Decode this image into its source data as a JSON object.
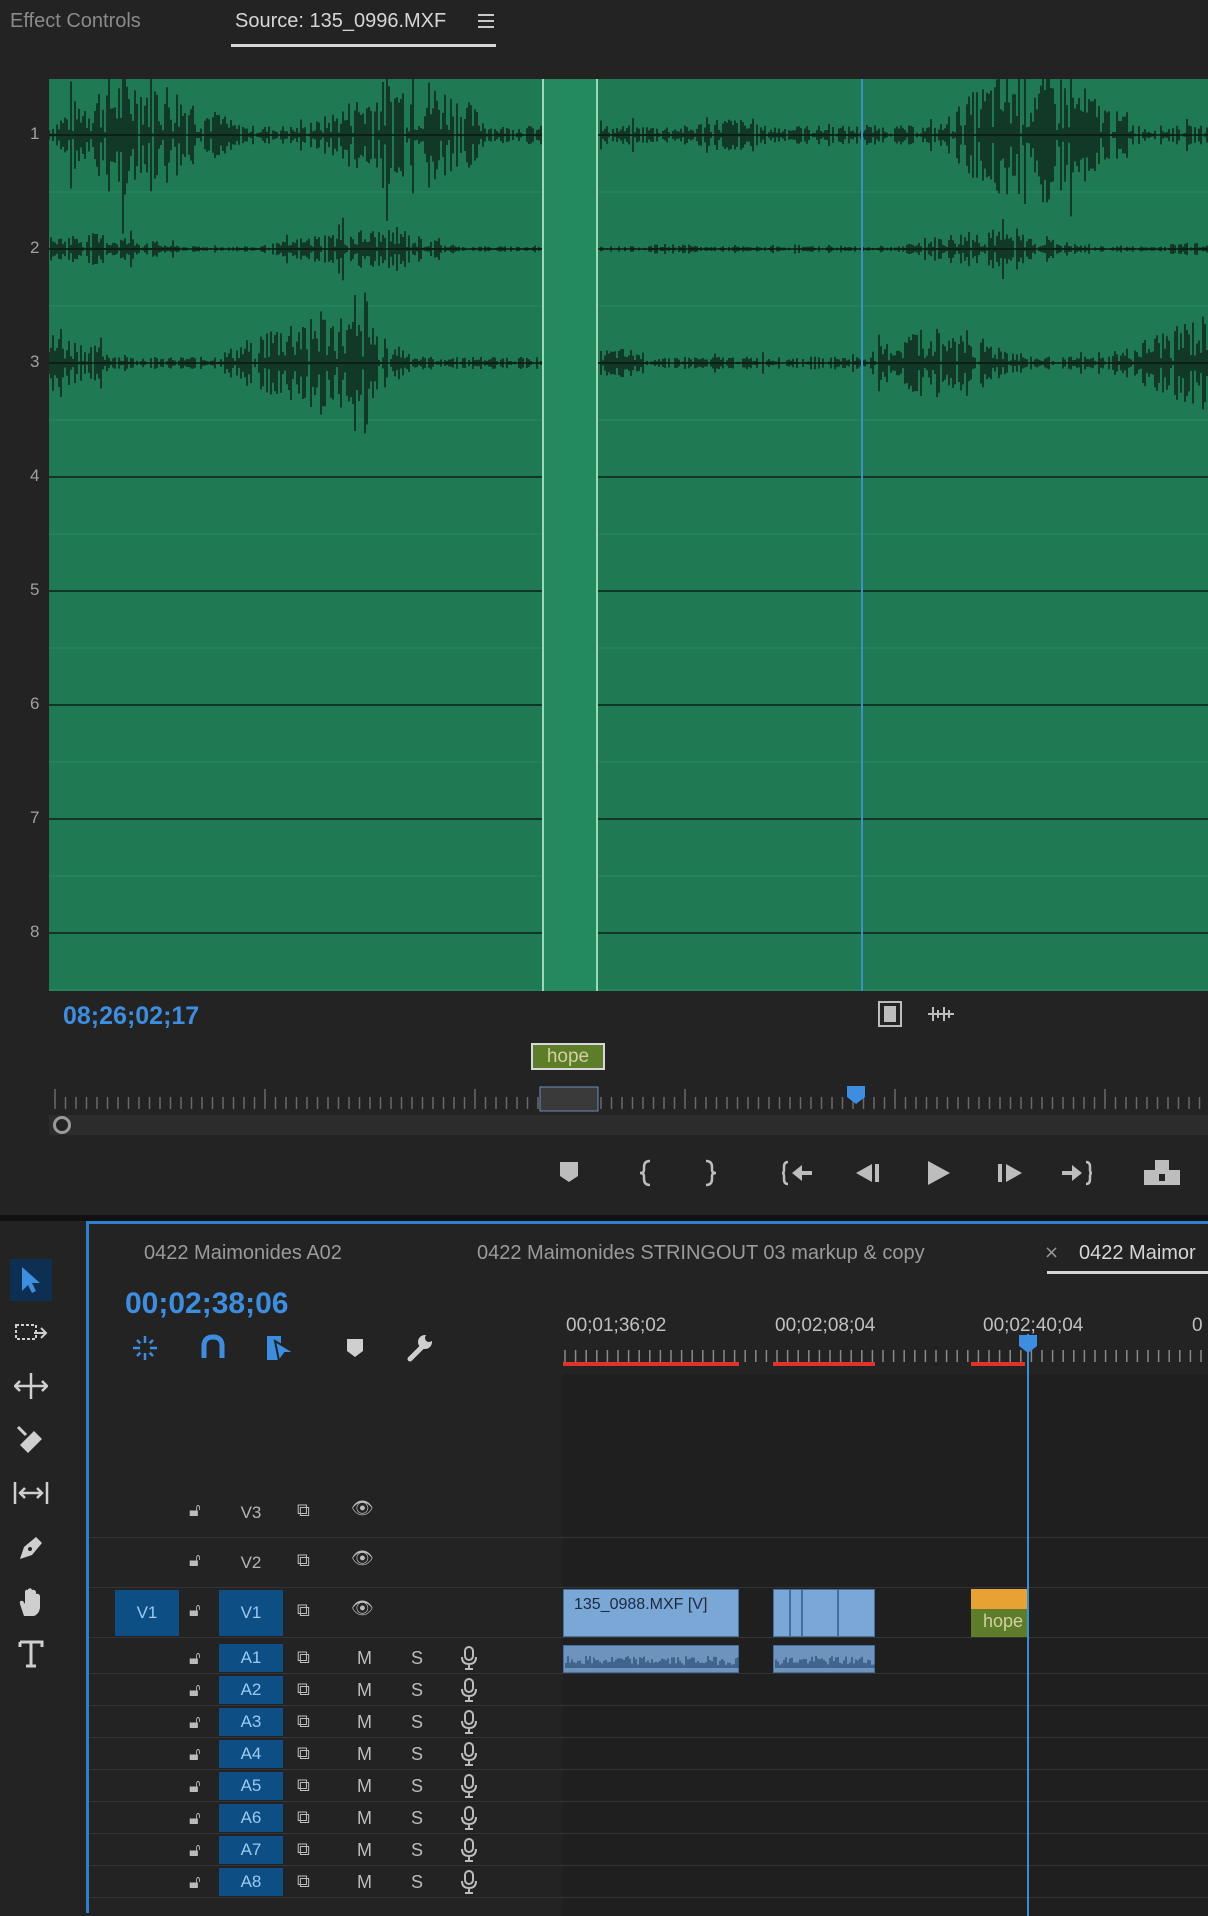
{
  "source_panel": {
    "tabs": [
      "Effect Controls",
      "Source: 135_0996.MXF"
    ],
    "channels": [
      "1",
      "2",
      "3",
      "4",
      "5",
      "6",
      "7",
      "8"
    ],
    "timecode": "08;26;02;17",
    "marker_label": "hope",
    "colors": {
      "waveform_bg": "#1f7a54",
      "timecode": "#3d8ee0",
      "marker": "#5d7d2a"
    },
    "controls": [
      "add-marker-icon",
      "mark-in-icon",
      "mark-out-icon",
      "go-to-in-icon",
      "step-back-icon",
      "play-icon",
      "step-forward-icon",
      "go-to-out-icon",
      "insert-icon"
    ]
  },
  "toolbar": {
    "tools": [
      "selection-tool-icon",
      "track-select-tool-icon",
      "ripple-edit-tool-icon",
      "razor-tool-icon",
      "slip-tool-icon",
      "pen-tool-icon",
      "hand-tool-icon",
      "type-tool-icon"
    ]
  },
  "timeline": {
    "tabs": [
      "0422 Maimonides A02",
      "0422 Maimonides STRINGOUT 03 markup & copy",
      "0422 Maimor"
    ],
    "close_glyph": "×",
    "timecode": "00;02;38;06",
    "ruler_labels": [
      "00;01;36;02",
      "00;02;08;04",
      "00;02;40;04",
      "0"
    ],
    "video_tracks": [
      {
        "name": "V3",
        "source": ""
      },
      {
        "name": "V2",
        "source": ""
      },
      {
        "name": "V1",
        "source": "V1"
      }
    ],
    "audio_tracks": [
      "A1",
      "A2",
      "A3",
      "A4",
      "A5",
      "A6",
      "A7",
      "A8"
    ],
    "mute_label": "M",
    "solo_label": "S",
    "clips": {
      "v1_clip_1": "135_0988.MXF [V]",
      "v1_clip_3": "hope"
    },
    "colors": {
      "accent": "#3d8ee0",
      "video_clip": "#7aa7d6",
      "audio_clip": "#6e93bd",
      "in_out_bar": "#e0342b",
      "marker_clip": "#e8a234"
    }
  }
}
